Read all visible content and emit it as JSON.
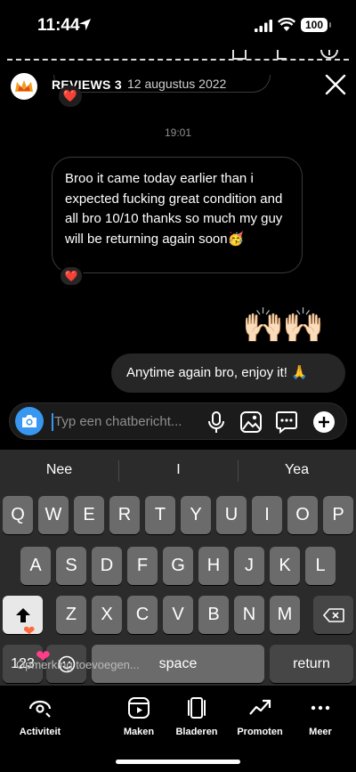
{
  "status_bar": {
    "time": "11:44",
    "battery": "100"
  },
  "header": {
    "name": "REVIEWS 3",
    "date": "12 augustus 2022"
  },
  "thread": {
    "timestamp": "19:01",
    "incoming_text": "Broo it came today earlier than i expected fucking great condition and all bro 10/10 thanks so much my guy will be returning again soon🥳",
    "reaction": "❤️",
    "emoji_message": "🙌🏻🙌🏻",
    "outgoing_text": "Anytime again bro, enjoy it! 🙏"
  },
  "composer": {
    "placeholder": "Typ een chatbericht..."
  },
  "keyboard": {
    "suggestions": [
      "Nee",
      "I",
      "Yea"
    ],
    "row1": [
      "Q",
      "W",
      "E",
      "R",
      "T",
      "Y",
      "U",
      "I",
      "O",
      "P"
    ],
    "row2": [
      "A",
      "S",
      "D",
      "F",
      "G",
      "H",
      "J",
      "K",
      "L"
    ],
    "row3": [
      "Z",
      "X",
      "C",
      "V",
      "B",
      "N",
      "M"
    ],
    "numbers_key": "123",
    "space_key": "space",
    "return_key": "return",
    "overlay_text": "Opmerking toevoegen..."
  },
  "actions": [
    {
      "label": "Activiteit",
      "icon": "activity-icon"
    },
    {
      "label": "Maken",
      "icon": "create-icon"
    },
    {
      "label": "Bladeren",
      "icon": "browse-icon"
    },
    {
      "label": "Promoten",
      "icon": "promote-icon"
    },
    {
      "label": "Meer",
      "icon": "more-icon"
    }
  ]
}
